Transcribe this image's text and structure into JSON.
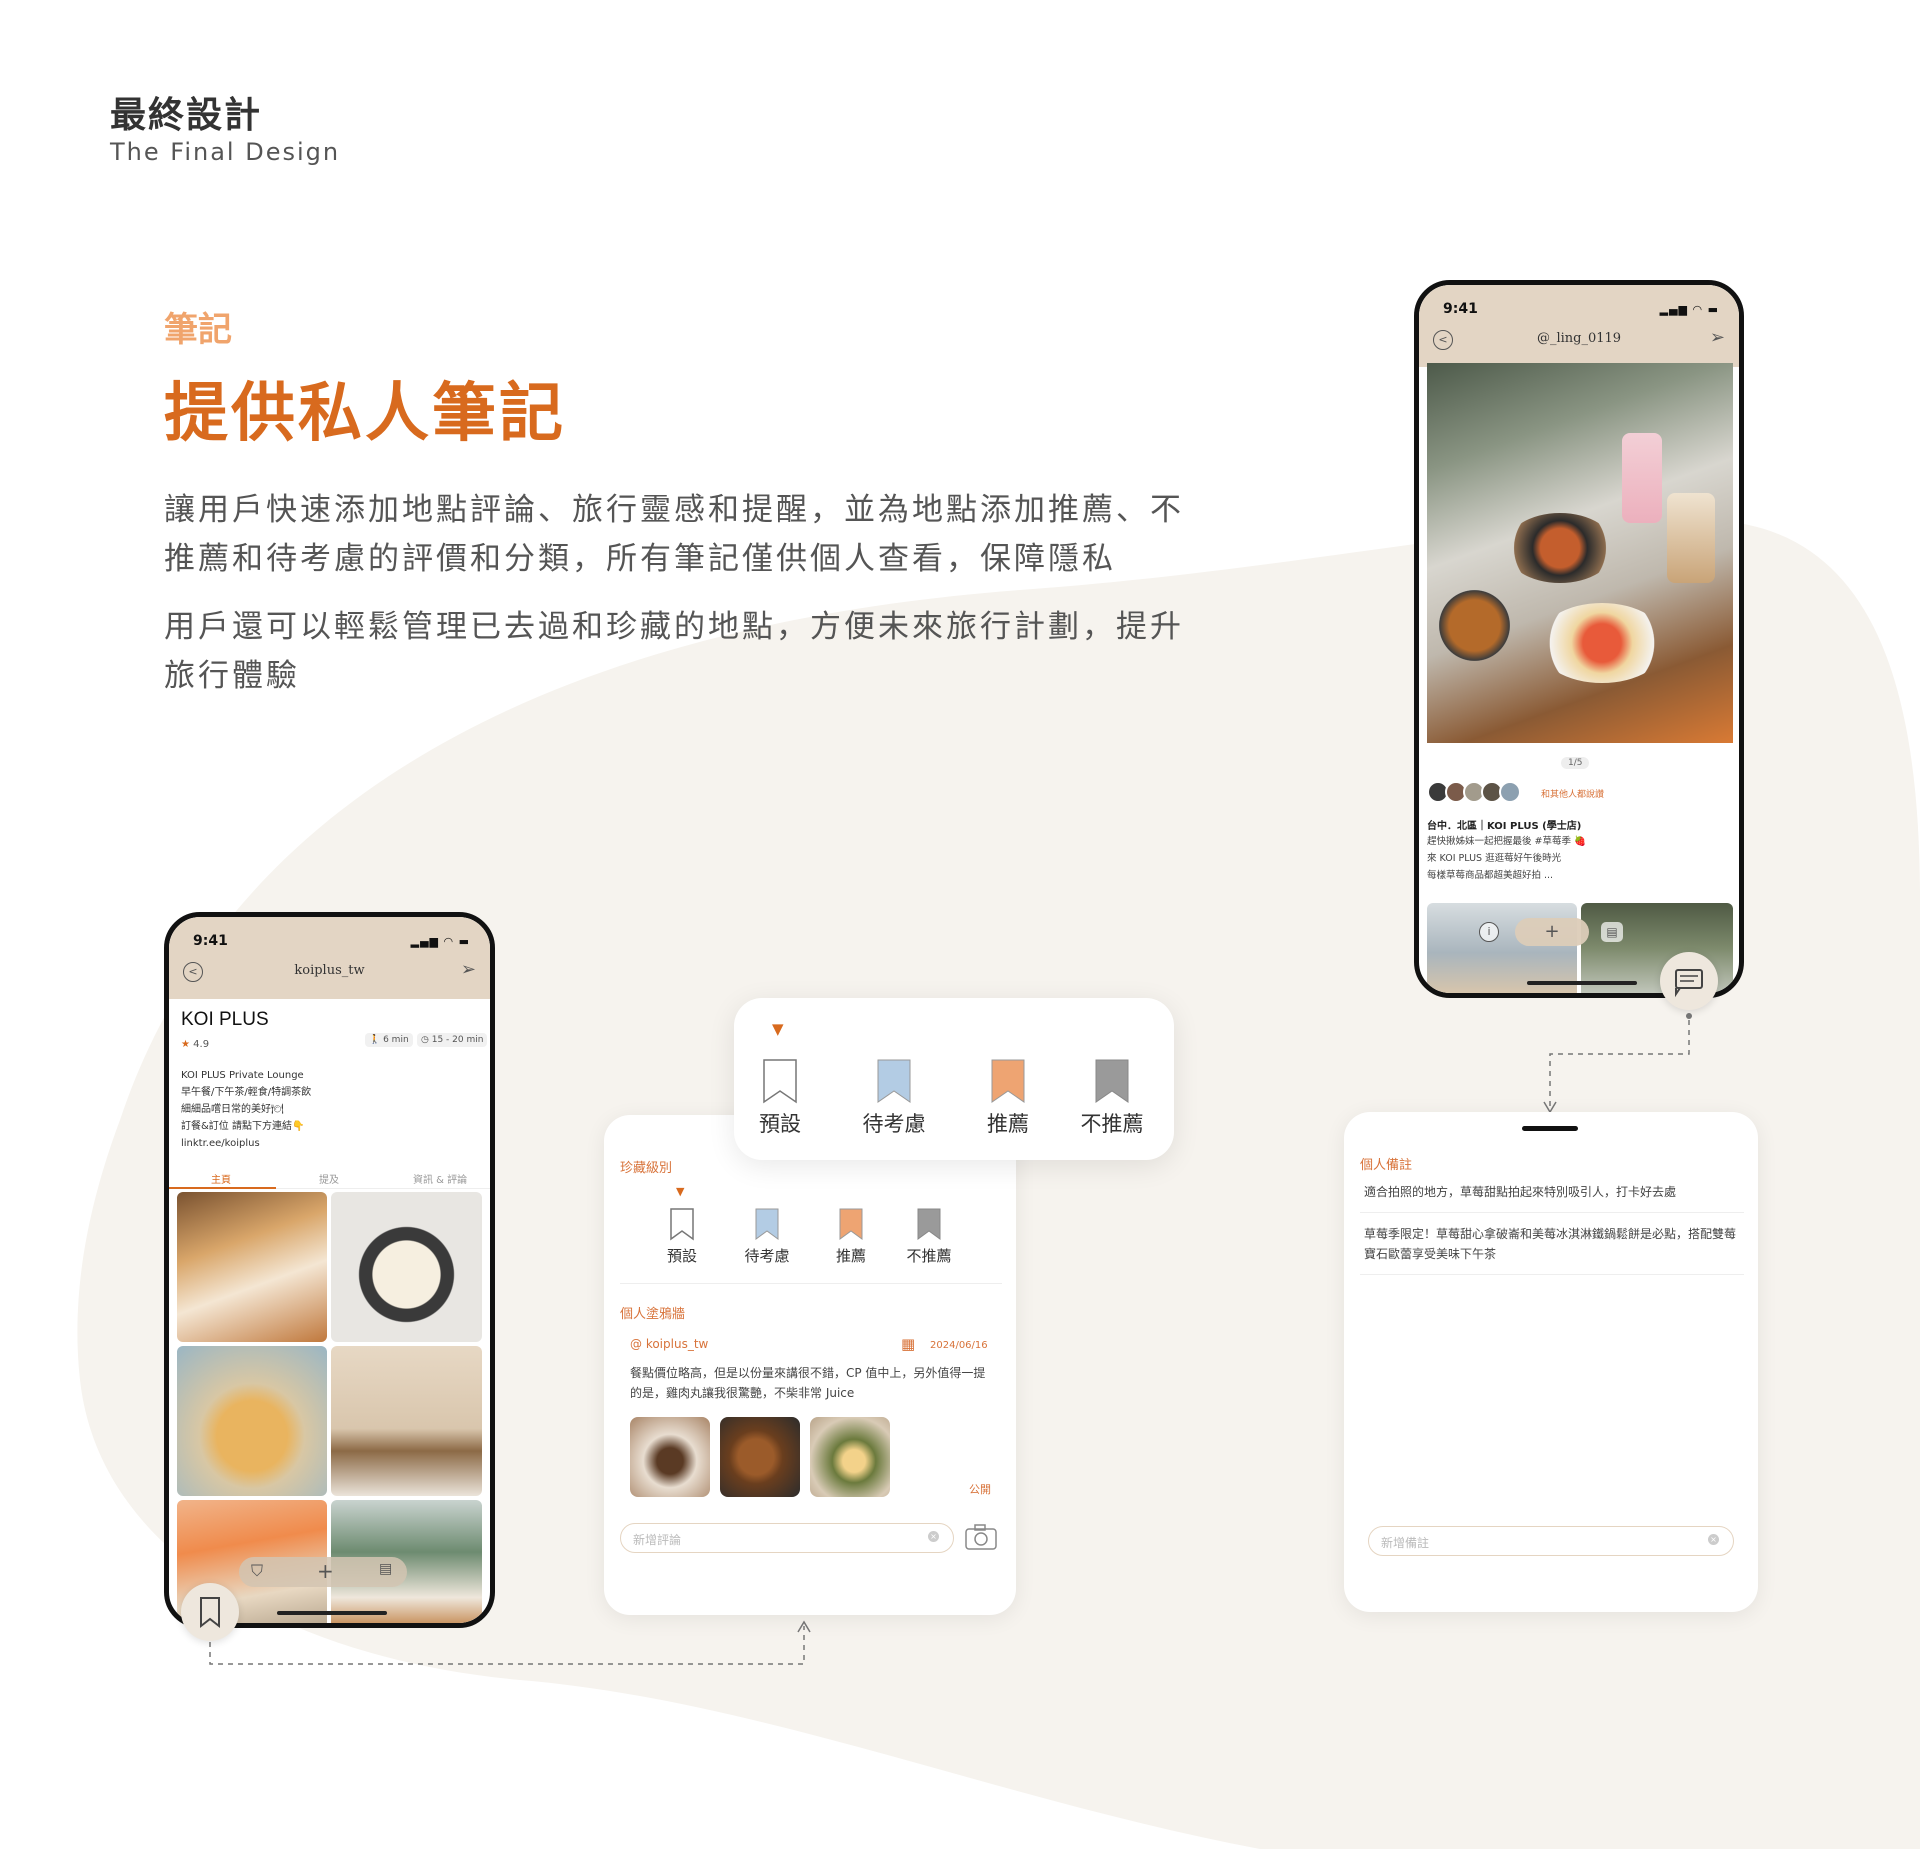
{
  "header": {
    "title_zh": "最終設計",
    "title_en": "The Final Design"
  },
  "section": {
    "tag": "筆記",
    "title": "提供私人筆記",
    "para1": "讓用戶快速添加地點評論、旅行靈感和提醒，並為地點添加推薦、不推薦和待考慮的評價和分類，所有筆記僅供個人查看，保障隱私",
    "para2": "用戶還可以輕鬆管理已去過和珍藏的地點，方便未來旅行計劃，提升旅行體驗"
  },
  "phone_left": {
    "time": "9:41",
    "handle": "koiplus_tw",
    "place_name": "KOI PLUS",
    "rating": "4.9",
    "walk": "6 min",
    "wait": "15 - 20 min",
    "bio": [
      "KOI PLUS Private Lounge",
      "早午餐/下午茶/輕食/特調茶飲",
      "細細品嚐日常的美好🍽",
      "訂餐&訂位 請點下方連結👇",
      "linktr.ee/koiplus"
    ],
    "tabs": [
      "主頁",
      "提及",
      "資訊 & 評論"
    ],
    "add_label": "+"
  },
  "popup_bookmarks": {
    "items": [
      "預設",
      "待考慮",
      "推薦",
      "不推薦"
    ],
    "colors": [
      "#ffffff",
      "#b3cce4",
      "#eea472",
      "#9a9a9a"
    ]
  },
  "middle_card": {
    "collection_title": "珍藏級別",
    "items": [
      "預設",
      "待考慮",
      "推薦",
      "不推薦"
    ],
    "graffiti_title": "個人塗鴉牆",
    "user": "@ koiplus_tw",
    "date": "2024/06/16",
    "comment": "餐點價位略高，但是以份量來講很不錯，CP 值中上，另外值得一提的是，雞肉丸讓我很驚艷，不柴非常 Juice",
    "visibility": "公開",
    "input_placeholder": "新增評論"
  },
  "phone_right": {
    "time": "9:41",
    "handle": "@_ling_0119",
    "pager": "1/5",
    "liked_text": "和其他人都說讚",
    "caption_title": "台中．北區｜KOI PLUS (學士店)",
    "caption_lines": [
      "趕快揪姊妹一起把握最後 #草莓季 🍓",
      "來 KOI PLUS 逛逛莓好午後時光",
      "每樣草莓商品都超美超好拍 ..."
    ],
    "info_icon": "i",
    "add_label": "+"
  },
  "notes_card": {
    "title": "個人備註",
    "note1": "適合拍照的地方，草莓甜點拍起來特別吸引人，打卡好去處",
    "note2": "草莓季限定！草莓甜心拿破崙和美莓冰淇淋鐵鍋鬆餅是必點，搭配雙莓寶石歐蕾享受美味下午茶",
    "input_placeholder": "新增備註"
  },
  "colors": {
    "accent": "#d86a1e",
    "accent_light": "#f0a46c",
    "beige": "#e3d5c4",
    "blob": "#f6f3ee"
  }
}
